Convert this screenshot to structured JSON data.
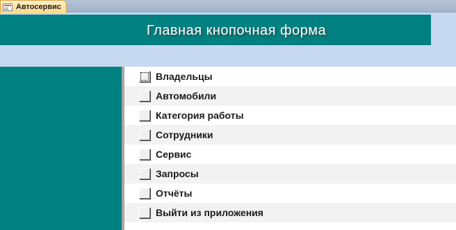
{
  "tab": {
    "label": "Автосервис",
    "icon": "form-icon"
  },
  "header": {
    "title": "Главная кнопочная форма"
  },
  "colors": {
    "teal": "#008080",
    "background": "#c7d9f1",
    "row_alt": "#f2f2f2"
  },
  "menu": {
    "items": [
      {
        "label": "Владельцы"
      },
      {
        "label": "Автомобили"
      },
      {
        "label": "Категория работы"
      },
      {
        "label": "Сотрудники"
      },
      {
        "label": "Сервис"
      },
      {
        "label": "Запросы"
      },
      {
        "label": "Отчёты"
      },
      {
        "label": "Выйти из приложения"
      }
    ]
  }
}
